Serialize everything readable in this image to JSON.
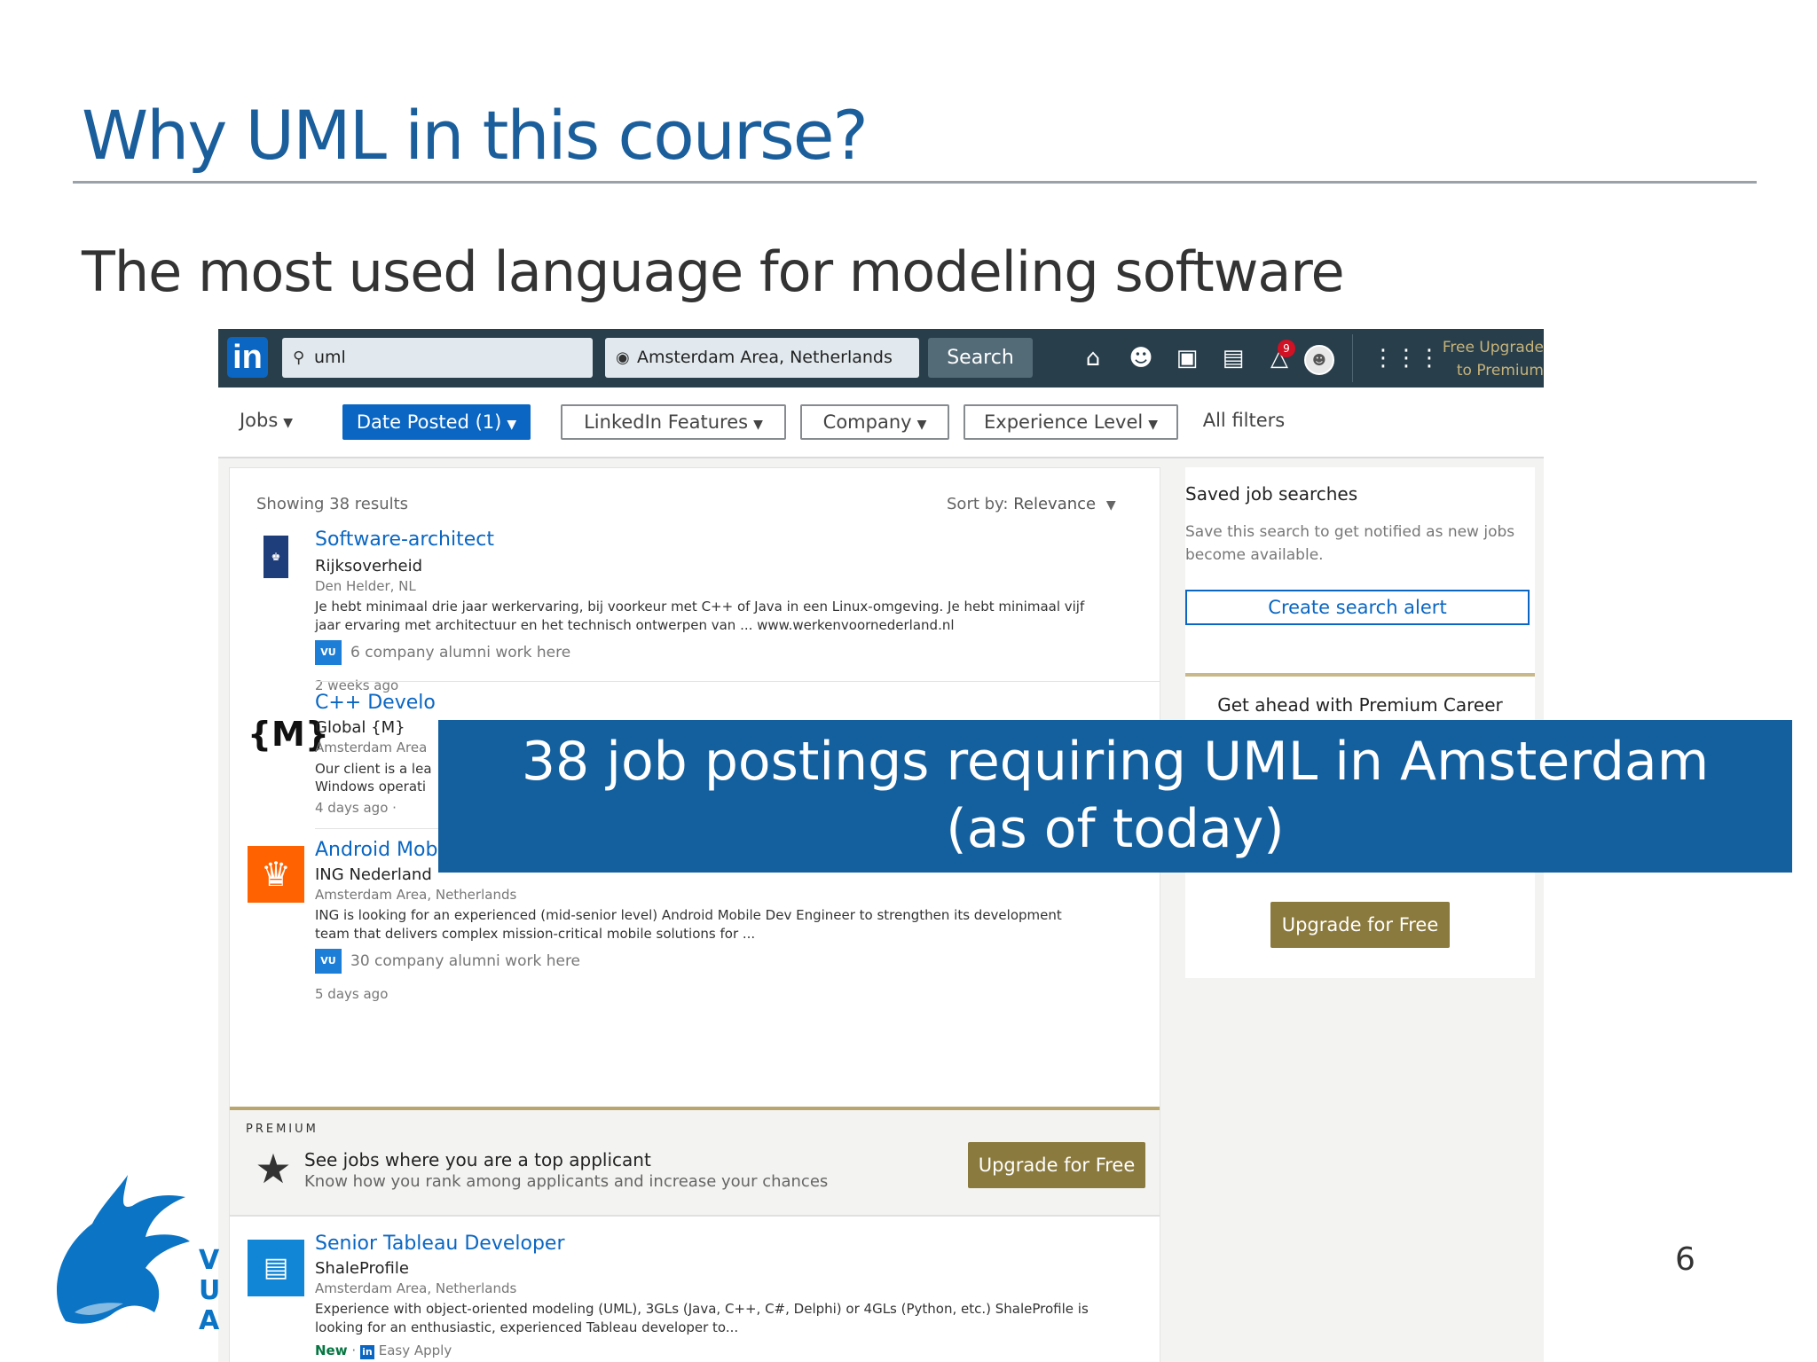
{
  "slide": {
    "title": "Why UML in this course?",
    "subtitle": "The most used language for modeling software",
    "page_number": "6",
    "logo_letters": [
      "V",
      "U",
      "A"
    ]
  },
  "overlay": {
    "line1": "38 job postings requiring UML in Amsterdam",
    "line2": "(as of today)"
  },
  "linkedin": {
    "logo": "in",
    "search_value": "uml",
    "location_value": "Amsterdam Area, Netherlands",
    "search_button": "Search",
    "nav_icons": [
      "home-icon",
      "network-icon",
      "jobs-icon",
      "messaging-icon",
      "notifications-icon",
      "profile-avatar"
    ],
    "notification_count": "9",
    "premium_link_line1": "Free Upgrade",
    "premium_link_line2": "to Premium",
    "filters": {
      "jobs": "Jobs",
      "date_posted": "Date Posted (1)",
      "linkedin_features": "LinkedIn Features",
      "company": "Company",
      "experience_level": "Experience Level",
      "all_filters": "All filters"
    },
    "results_count": "Showing 38 results",
    "sort_label": "Sort by:",
    "sort_value": "Relevance",
    "jobs": [
      {
        "title": "Software-architect",
        "company": "Rijksoverheid",
        "location": "Den Helder, NL",
        "description": "Je hebt minimaal drie jaar werkervaring, bij voorkeur met C++ of Java in een Linux-omgeving. Je hebt minimaal vijf jaar ervaring met architectuur en het technisch ontwerpen van ... www.werkenvoornederland.nl",
        "alumni": "6 company alumni work here",
        "posted": "2 weeks ago"
      },
      {
        "title": "C++ Develo",
        "company": "Global {M}",
        "location": "Amsterdam Area",
        "description_line1": "Our client is a lea",
        "description_line2": "Windows operati",
        "posted": "4 days ago ·",
        "logo_text": "{M}"
      },
      {
        "title": "Android Mobile Dev Engineer",
        "company": "ING Nederland",
        "location": "Amsterdam Area, Netherlands",
        "description": "ING is looking for an experienced (mid-senior level) Android Mobile Dev Engineer to strengthen its development team that delivers complex mission-critical mobile solutions for ...",
        "alumni": "30 company alumni work here",
        "posted": "5 days ago"
      },
      {
        "title": "Senior Tableau Developer",
        "company": "ShaleProfile",
        "location": "Amsterdam Area, Netherlands",
        "description": "Experience with object-oriented modeling (UML), 3GLs (Java, C++, C#, Delphi) or 4GLs (Python, etc.) ShaleProfile is looking for an enthusiastic, experienced Tableau developer to...",
        "new_label": "New",
        "easy_apply": "Easy Apply"
      }
    ],
    "alumni_badge": "VU",
    "premium_banner": {
      "label": "PREMIUM",
      "headline": "See jobs where you are a top applicant",
      "sub": "Know how you rank among applicants and increase your chances",
      "button": "Upgrade for Free"
    },
    "saved_searches": {
      "title": "Saved job searches",
      "description": "Save this search to get notified as new jobs become available.",
      "button": "Create search alert"
    },
    "career_card": {
      "title": "Get ahead with Premium Career",
      "button": "Upgrade for Free"
    }
  },
  "colors": {
    "title_blue": "#1b5e9c",
    "linkedin_nav": "#283e4a",
    "linkedin_blue": "#0a66c2",
    "premium_gold": "#8b7a3e",
    "overlay_blue": "#14609f"
  }
}
